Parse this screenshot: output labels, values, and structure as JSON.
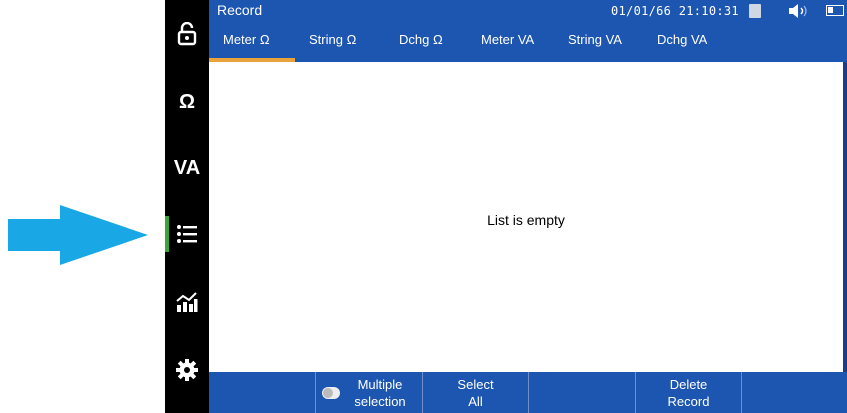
{
  "header": {
    "title": "Record",
    "datetime": "01/01/66  21:10:31"
  },
  "sidebar": {
    "items": [
      {
        "icon": "unlock-icon",
        "label": ""
      },
      {
        "icon": "ohm-icon",
        "label": "Ω"
      },
      {
        "icon": "va-icon",
        "label": "VA"
      },
      {
        "icon": "list-icon",
        "label": "",
        "active": true
      },
      {
        "icon": "chart-icon",
        "label": ""
      },
      {
        "icon": "gear-icon",
        "label": ""
      }
    ]
  },
  "tabs": [
    {
      "label": "Meter Ω",
      "active": true
    },
    {
      "label": "String Ω"
    },
    {
      "label": "Dchg Ω"
    },
    {
      "label": "Meter VA"
    },
    {
      "label": "String VA"
    },
    {
      "label": "Dchg VA"
    }
  ],
  "main": {
    "empty_message": "List is empty"
  },
  "footer": {
    "multiple_selection_line1": "Multiple",
    "multiple_selection_line2": "selection",
    "select_all_line1": "Select",
    "select_all_line2": "All",
    "delete_record_line1": "Delete",
    "delete_record_line2": "Record"
  },
  "colors": {
    "header_blue": "#1d56b0",
    "tab_active_underline": "#e8a33a",
    "sidebar_active": "#3aa638",
    "arrow": "#1aa7e6"
  }
}
